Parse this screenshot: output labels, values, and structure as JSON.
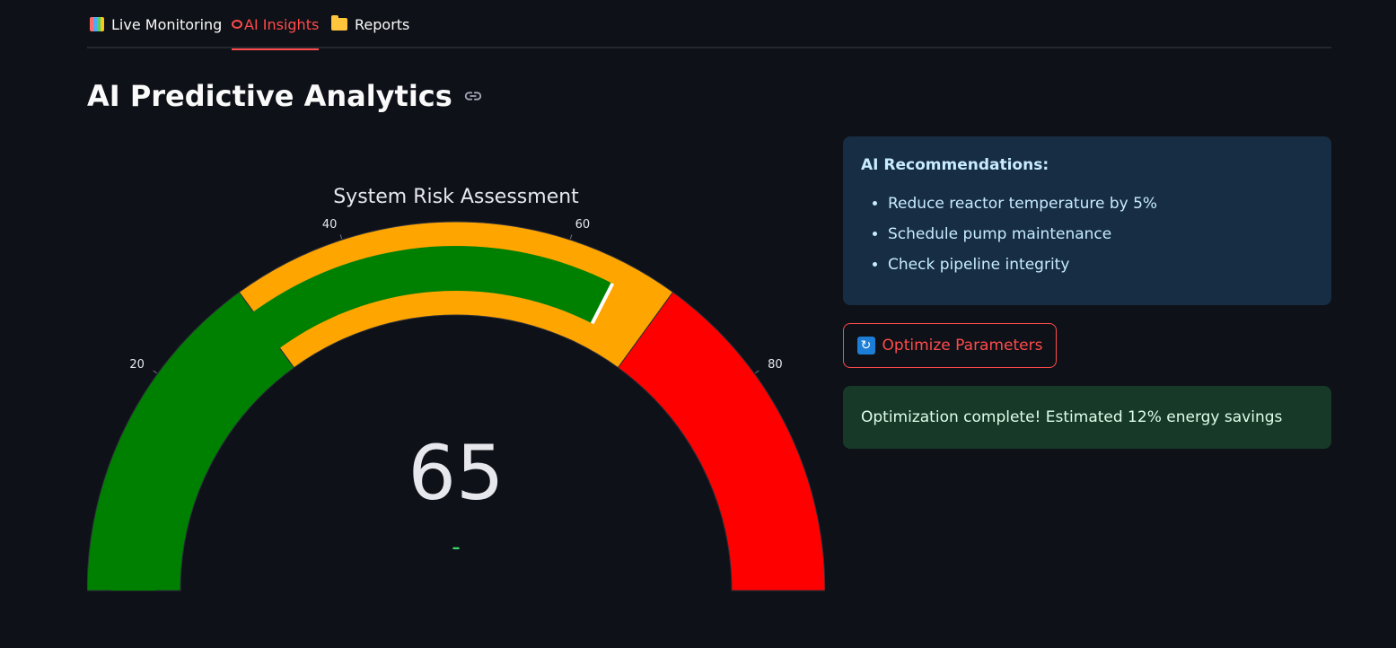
{
  "tabs": [
    {
      "label": "Live Monitoring",
      "icon": "bar-chart-icon",
      "active": false
    },
    {
      "label": "AI Insights",
      "icon": "brain-icon",
      "active": true
    },
    {
      "label": "Reports",
      "icon": "folder-icon",
      "active": false
    }
  ],
  "page_title": "AI Predictive Analytics",
  "gauge": {
    "title": "System Risk Assessment",
    "value": 65,
    "value_text": "65",
    "delta_text": "–",
    "range": [
      0,
      100
    ],
    "ticks": [
      {
        "value": 20,
        "label": "20"
      },
      {
        "value": 40,
        "label": "40"
      },
      {
        "value": 60,
        "label": "60"
      },
      {
        "value": 80,
        "label": "80"
      }
    ],
    "steps": [
      {
        "range": [
          0,
          30
        ],
        "color": "#008000"
      },
      {
        "range": [
          30,
          70
        ],
        "color": "#ffa500"
      },
      {
        "range": [
          70,
          100
        ],
        "color": "#ff0000"
      }
    ],
    "bar_color": "#008000",
    "threshold": 65,
    "threshold_color": "#ffffff"
  },
  "recommendations": {
    "heading": "AI Recommendations:",
    "items": [
      "Reduce reactor temperature by 5%",
      "Schedule pump maintenance",
      "Check pipeline integrity"
    ]
  },
  "optimize_button": {
    "label": "Optimize Parameters",
    "icon": "refresh-icon"
  },
  "success_message": "Optimization complete! Estimated 12% energy savings",
  "colors": {
    "accent": "#ff4b4b",
    "background": "#0e1117",
    "info_bg": "#172d43",
    "success_bg": "#173928"
  }
}
